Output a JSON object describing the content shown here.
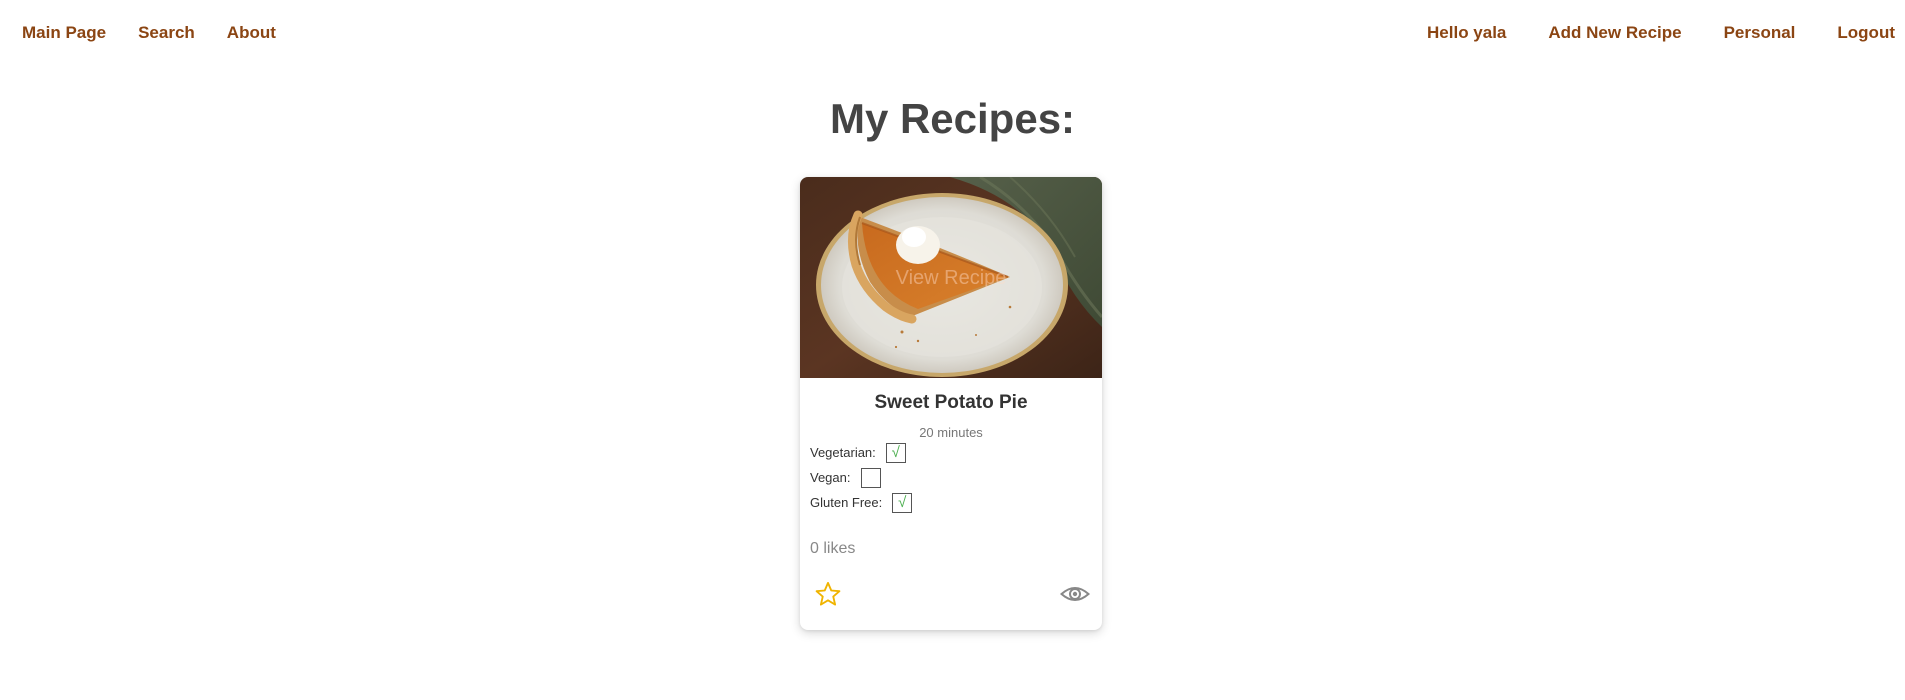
{
  "nav": {
    "left": [
      {
        "label": "Main Page"
      },
      {
        "label": "Search"
      },
      {
        "label": "About"
      }
    ],
    "greeting": "Hello yala",
    "right": [
      {
        "label": "Add New Recipe"
      },
      {
        "label": "Personal"
      },
      {
        "label": "Logout"
      }
    ]
  },
  "page": {
    "title": "My Recipes:"
  },
  "recipe": {
    "image_overlay": "View Recipe",
    "title": "Sweet Potato Pie",
    "time": "20 minutes",
    "diet": [
      {
        "label": "Vegetarian:",
        "checked": true,
        "mark": "√"
      },
      {
        "label": "Vegan:",
        "checked": false,
        "mark": ""
      },
      {
        "label": "Gluten Free:",
        "checked": true,
        "mark": "√"
      }
    ],
    "likes": "0 likes",
    "icons": {
      "favorite": "star-outline-icon",
      "view": "eye-icon"
    }
  },
  "colors": {
    "nav_link": "#8b4513",
    "title": "#444444",
    "star": "#f0b400",
    "check": "#4caf50"
  }
}
